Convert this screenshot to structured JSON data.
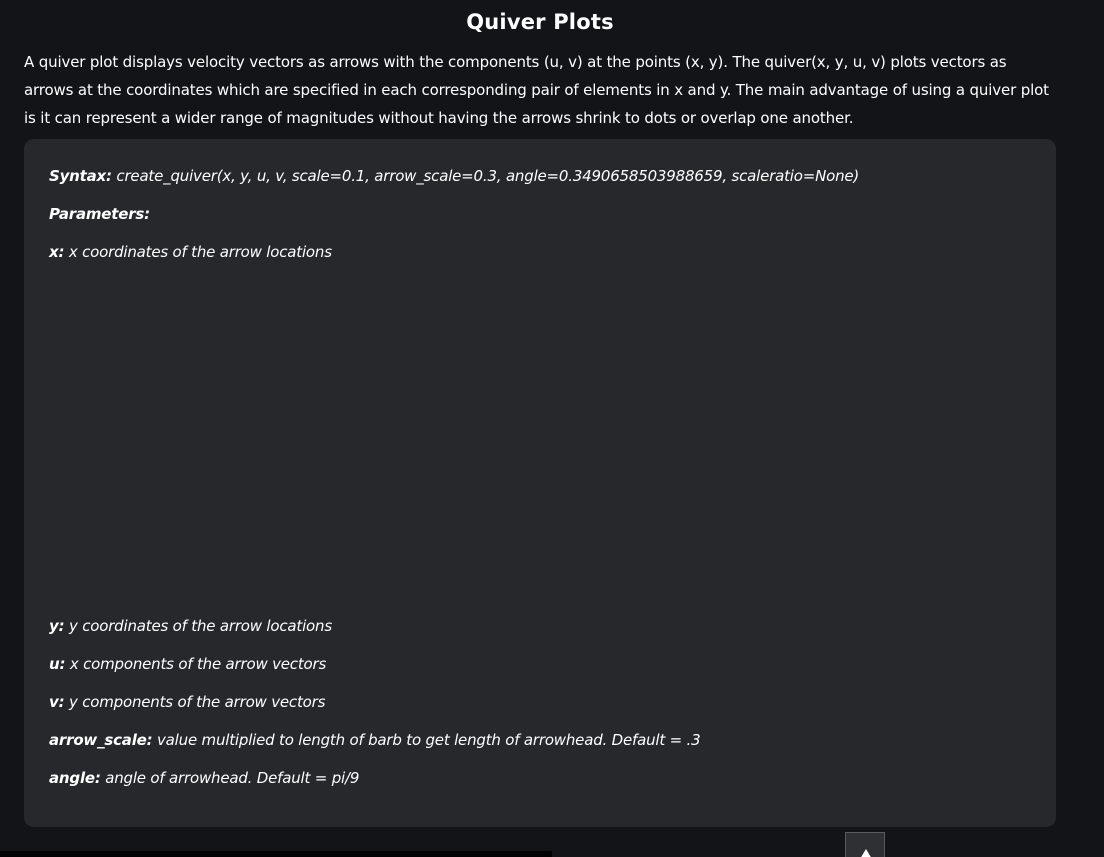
{
  "article": {
    "title": "Quiver Plots",
    "intro": "A quiver plot displays velocity vectors as arrows with the components (u, v) at the points (x, y). The quiver(x, y, u, v) plots vectors as arrows at the coordinates which are specified in each corresponding pair of elements in x and y. The main advantage of using a quiver plot is it can represent a wider range of magnitudes without having the arrows shrink to dots or overlap one another."
  },
  "card": {
    "syntax_label": "Syntax:",
    "syntax_value": " create_quiver(x, y, u, v, scale=0.1, arrow_scale=0.3, angle=0.3490658503988659, scaleratio=None)",
    "parameters_label": "Parameters:",
    "params": [
      {
        "name": "x:",
        "desc": " x coordinates of the arrow locations"
      },
      {
        "name": "y:",
        "desc": " y coordinates of the arrow locations"
      },
      {
        "name": "u:",
        "desc": " x components of the arrow vectors"
      },
      {
        "name": "v:",
        "desc": " y components of the arrow vectors"
      },
      {
        "name": "arrow_scale:",
        "desc": " value multiplied to length of barb to get length of arrowhead. Default = .3"
      },
      {
        "name": "angle:",
        "desc": " angle of arrowhead. Default = pi/9"
      }
    ]
  },
  "scroll_top": {
    "icon": "arrow-up-icon",
    "color": "#ffffff"
  }
}
